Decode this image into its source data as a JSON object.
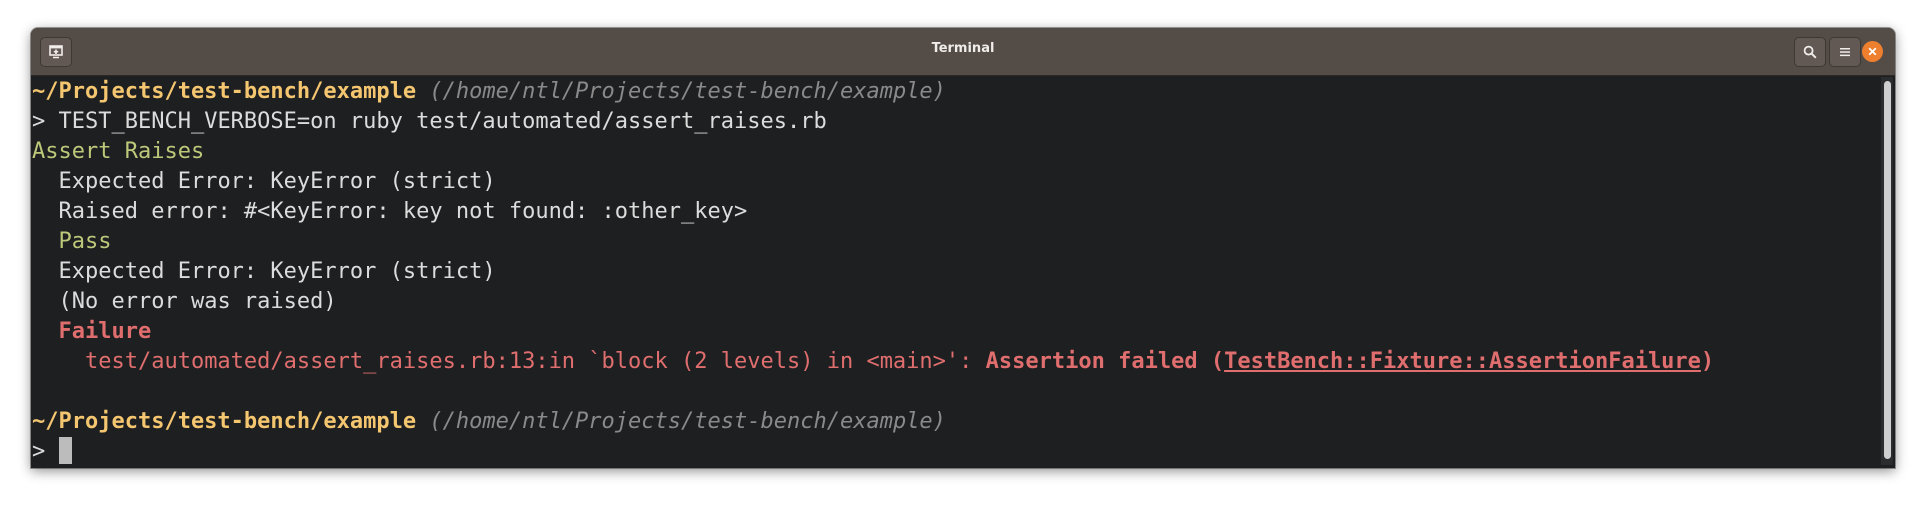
{
  "window": {
    "title": "Terminal",
    "new_tab_icon": "new-tab-icon",
    "search_icon": "search-icon",
    "menu_icon": "hamburger-menu-icon",
    "close_icon": "close-icon"
  },
  "terminal": {
    "prompt1": {
      "dir": "~/Projects/test-bench/example",
      "path": "(/home/ntl/Projects/test-bench/example)"
    },
    "command": {
      "prompt": ">",
      "text": "TEST_BENCH_VERBOSE=on ruby test/automated/assert_raises.rb"
    },
    "output": {
      "context": "Assert Raises",
      "expected1": "Expected Error: KeyError (strict)",
      "raised": "Raised error: #<KeyError: key not found: :other_key>",
      "pass": "Pass",
      "expected2": "Expected Error: KeyError (strict)",
      "no_error": "(No error was raised)",
      "failure": "Failure",
      "trace_location": "test/automated/assert_raises.rb:13:in `block (2 levels) in <main>':",
      "assertion_failed": "Assertion failed",
      "open_paren": "(",
      "failure_class": "TestBench::Fixture::AssertionFailure",
      "close_paren": ")"
    },
    "prompt2": {
      "dir": "~/Projects/test-bench/example",
      "path": "(/home/ntl/Projects/test-bench/example)",
      "prompt": ">"
    }
  },
  "colors": {
    "background": "#1e1f21",
    "titlebar": "#544c47",
    "dir": "#f5c670",
    "pass": "#bec87a",
    "failure": "#e06e6e",
    "close": "#ee7f2f"
  }
}
